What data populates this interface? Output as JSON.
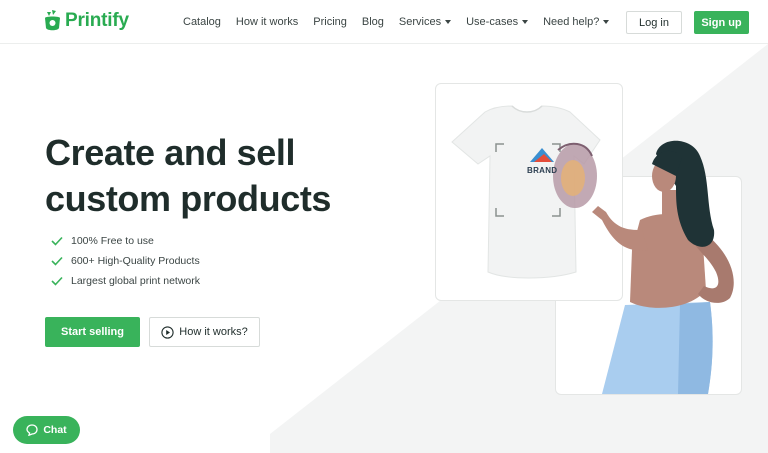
{
  "brand": {
    "name": "Printify",
    "logo_icon": "printify-logo-icon",
    "color": "#29ab51"
  },
  "nav": {
    "items": [
      {
        "label": "Catalog",
        "dropdown": false
      },
      {
        "label": "How it works",
        "dropdown": false
      },
      {
        "label": "Pricing",
        "dropdown": false
      },
      {
        "label": "Blog",
        "dropdown": false
      },
      {
        "label": "Services",
        "dropdown": true
      },
      {
        "label": "Use-cases",
        "dropdown": true
      },
      {
        "label": "Need help?",
        "dropdown": true
      }
    ],
    "login_label": "Log in",
    "signup_label": "Sign up"
  },
  "hero": {
    "title_line1": "Create and sell",
    "title_line2": "custom products",
    "features": [
      "100% Free to use",
      "600+ High-Quality Products",
      "Largest global print network"
    ],
    "primary_cta": "Start selling",
    "secondary_cta": "How it works?",
    "mockup_brand_text": "BRAND"
  },
  "chat": {
    "label": "Chat",
    "icon": "chat-bubble-icon"
  },
  "colors": {
    "accent": "#39b35b",
    "text": "#1f2d2b",
    "background_shape": "#f3f4f4"
  }
}
